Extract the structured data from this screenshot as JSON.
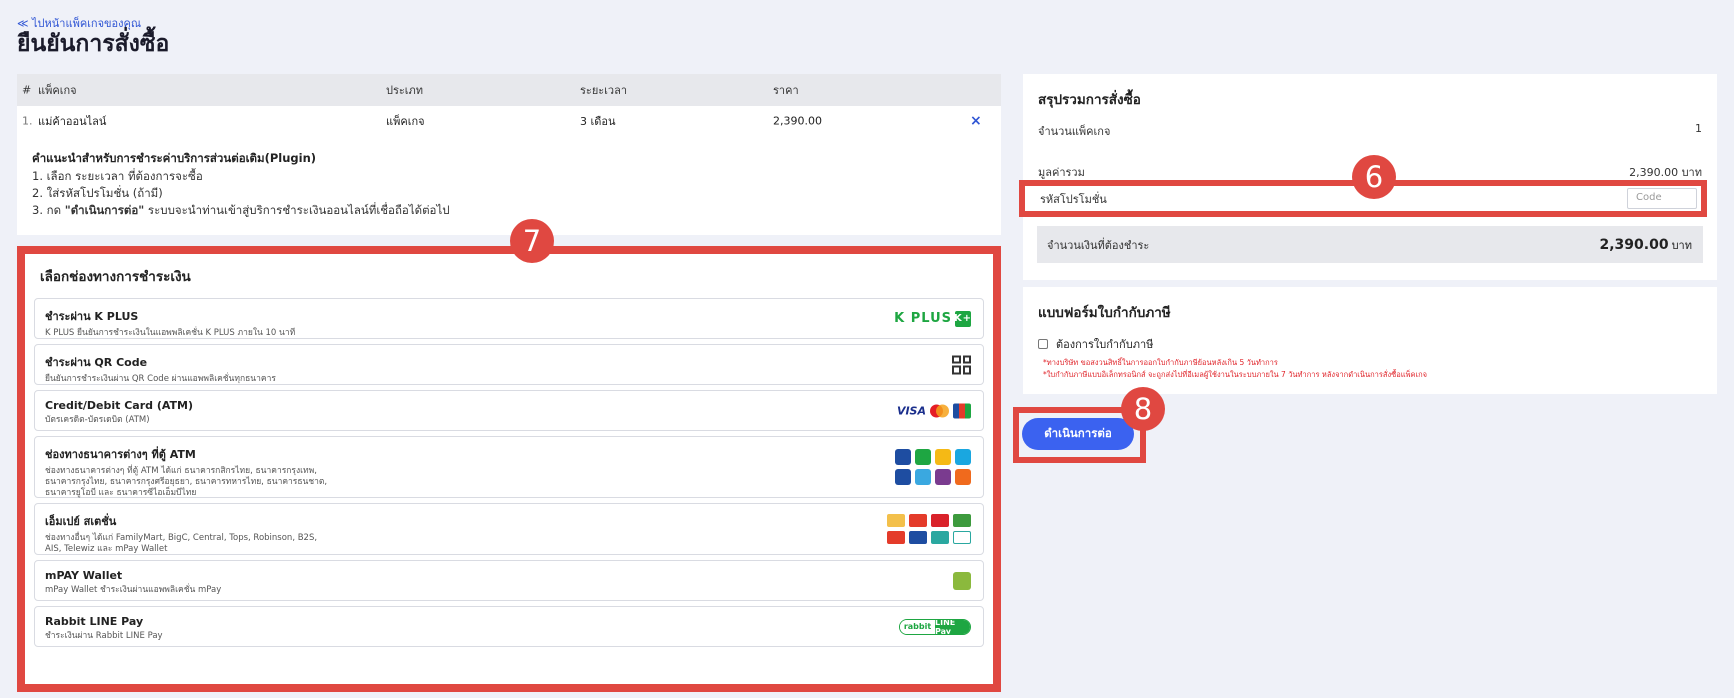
{
  "header": {
    "back_link": "≪ ไปหน้าแพ็คเกจของคุณ",
    "title": "ยืนยันการสั่งซื้อ"
  },
  "package_table": {
    "columns": [
      "#",
      "แพ็คเกจ",
      "ประเภท",
      "ระยะเวลา",
      "ราคา"
    ],
    "rows": [
      {
        "num": "1.",
        "package": "แม่ค้าออนไลน์",
        "type": "แพ็คเกจ",
        "duration": "3 เดือน",
        "price": "2,390.00",
        "remove": "×"
      }
    ]
  },
  "instructions": {
    "title": "คำแนะนำสำหรับการชำระค่าบริการส่วนต่อเติม(Plugin)",
    "step1": "1. เลือก ระยะเวลา ที่ต้องการจะซื้อ",
    "step2": "2. ใส่รหัสโปรโมชั่น (ถ้ามี)",
    "step3_prefix": "3. กด ",
    "step3_bold": "\"ดำเนินการต่อ\"",
    "step3_suffix": " ระบบจะนำท่านเข้าสู่บริการชำระเงินออนไลน์ที่เชื่อถือได้ต่อไป"
  },
  "payment": {
    "title": "เลือกช่องทางการชำระเงิน",
    "methods": [
      {
        "name": "ชำระผ่าน K PLUS",
        "desc": "K PLUS ยืนยันการชำระเงินในแอพพลิเคชั่น K PLUS ภายใน 10 นาที",
        "logo_text": "K PLUS",
        "logo_box": "K+"
      },
      {
        "name": "ชำระผ่าน QR Code",
        "desc": "ยืนยันการชำระเงินผ่าน QR Code ผ่านแอพพลิเคชั่นทุกธนาคาร"
      },
      {
        "name": "Credit/Debit Card (ATM)",
        "desc": "บัตรเครดิต-บัตรเดบิต (ATM)",
        "logo_text": "VISA"
      },
      {
        "name": "ช่องทางธนาคารต่างๆ ที่ตู้ ATM",
        "desc_lines": [
          "ช่องทางธนาคารต่างๆ ที่ตู้ ATM ได้แก่ ธนาคารกสิกรไทย, ธนาคารกรุงเทพ,",
          "ธนาคารกรุงไทย, ธนาคารกรุงศรีอยุธยา, ธนาคารทหารไทย, ธนาคารธนชาต,",
          "ธนาคารยูโอบี และ ธนาคารซีไอเอ็มบีไทย"
        ]
      },
      {
        "name": "เอ็มเปย์ สเตชั่น",
        "desc_lines": [
          "ช่องทางอื่นๆ ได้แก่ FamilyMart, BigC, Central, Tops, Robinson, B2S,",
          "AIS, Telewiz และ mPay Wallet"
        ]
      },
      {
        "name": "mPAY Wallet",
        "desc": "mPay Wallet ชำระเงินผ่านแอพพลิเคชั่น mPay"
      },
      {
        "name": "Rabbit LINE Pay",
        "desc": "ชำระเงินผ่าน Rabbit LINE Pay",
        "logo_left": "rabbit",
        "logo_right": "LINE Pay"
      }
    ],
    "colors": {
      "bank_icons": [
        "#1e4da1",
        "#1ea642",
        "#f5b915",
        "#1aa7e0",
        "#1e4da1",
        "#3aa8e0",
        "#7a3b8f",
        "#f06a1d"
      ],
      "store_icons": [
        "#f3c04b",
        "#e43b2a",
        "#d9222a",
        "#3d9a3d",
        "#e43b2a",
        "#1e4da1",
        "#2aa8a0",
        "#ffffff"
      ]
    }
  },
  "summary": {
    "title": "สรุปรวมการสั่งซื้อ",
    "package_count_label": "จำนวนแพ็คเกจ",
    "package_count": "1",
    "subtotal_label": "มูลค่ารวม",
    "subtotal": "2,390.00 บาท",
    "promo_label": "รหัสโปรโมชั่น",
    "promo_placeholder": "Code",
    "total_label": "จำนวนเงินที่ต้องชำระ",
    "total_amount": "2,390.00",
    "total_unit": "บาท"
  },
  "tax": {
    "title": "แบบฟอร์มใบกำกับภาษี",
    "checkbox_label": "ต้องการใบกำกับภาษี",
    "note1": "*ทางบริษัท ขอสงวนสิทธิ์ในการออกใบกำกับภาษีย้อนหลังเกิน 5 วันทำการ",
    "note2": "*ใบกำกับภาษีแบบอิเล็กทรอนิกส์ จะถูกส่งไปที่อีเมลผู้ใช้งานในระบบภายใน 7 วันทำการ หลังจากดำเนินการสั่งซื้อแพ็คเกจ"
  },
  "actions": {
    "continue": "ดำเนินการต่อ"
  },
  "annotations": {
    "promo": "6",
    "payment": "7",
    "continue": "8"
  },
  "colors": {
    "accent_red": "#e04841",
    "primary_blue": "#3b62f0",
    "kplus_green": "#1ea642"
  }
}
